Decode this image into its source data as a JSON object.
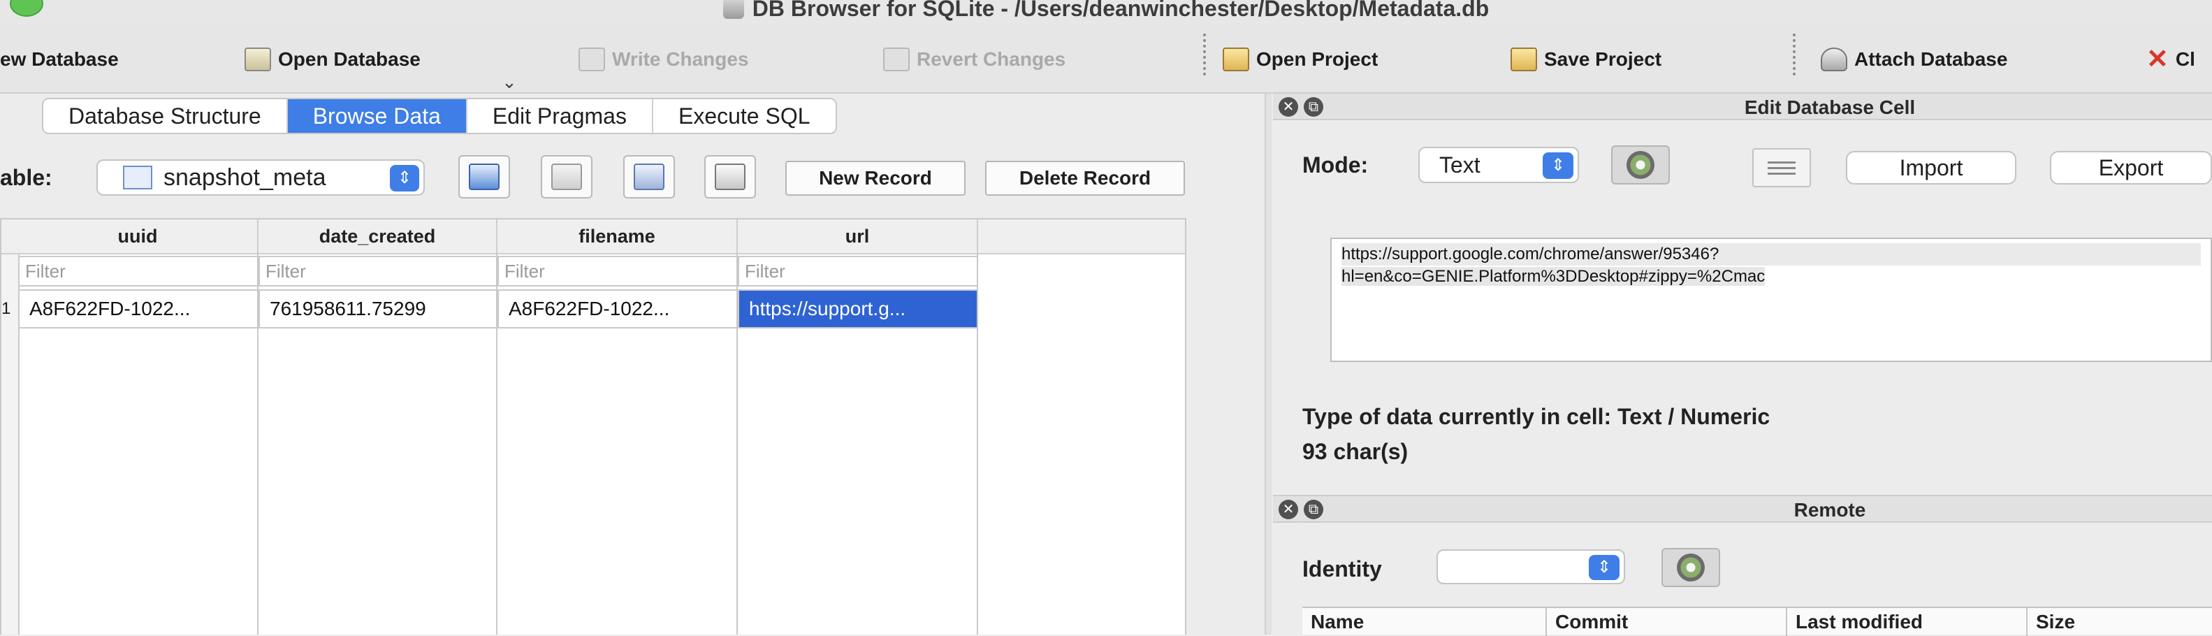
{
  "window": {
    "title": "DB Browser for SQLite - /Users/deanwinchester/Desktop/Metadata.db"
  },
  "toolbar": {
    "new_database": "ew Database",
    "open_database": "Open Database",
    "write_changes": "Write Changes",
    "revert_changes": "Revert Changes",
    "open_project": "Open Project",
    "save_project": "Save Project",
    "attach_database": "Attach Database",
    "close_database": "Cl"
  },
  "tabs": [
    {
      "label": "Database Structure",
      "active": false
    },
    {
      "label": "Browse Data",
      "active": true
    },
    {
      "label": "Edit Pragmas",
      "active": false
    },
    {
      "label": "Execute SQL",
      "active": false
    }
  ],
  "browse": {
    "table_label": "able:",
    "table_value": "snapshot_meta",
    "new_record": "New Record",
    "delete_record": "Delete Record"
  },
  "grid": {
    "columns": [
      "uuid",
      "date_created",
      "filename",
      "url"
    ],
    "filter_placeholder": "Filter",
    "rows": [
      {
        "num": "1",
        "cells": [
          "A8F622FD-1022...",
          "761958611.75299",
          "A8F622FD-1022...",
          "https://support.g..."
        ]
      }
    ]
  },
  "edit_cell": {
    "panel_title": "Edit Database Cell",
    "mode_label": "Mode:",
    "mode_value": "Text",
    "import": "Import",
    "export": "Export",
    "content_line1": "https://support.google.com/chrome/answer/95346?",
    "content_line2": "hl=en&co=GENIE.Platform%3DDesktop#zippy=%2Cmac",
    "type_info": "Type of data currently in cell: Text / Numeric",
    "char_count": "93 char(s)"
  },
  "remote": {
    "panel_title": "Remote",
    "identity_label": "Identity",
    "columns": [
      "Name",
      "Commit",
      "Last modified",
      "Size"
    ]
  },
  "colors": {
    "accent": "#3e7ee6",
    "selection": "#2f63d3",
    "close_red": "#d9342b"
  }
}
